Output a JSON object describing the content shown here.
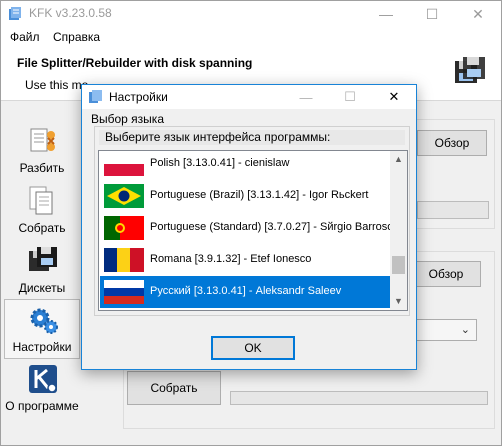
{
  "window": {
    "title": "KFK v3.23.0.58",
    "min_glyph": "—",
    "max_glyph": "☐",
    "close_glyph": "✕"
  },
  "menu": [
    "Файл",
    "Справка"
  ],
  "header": {
    "title": "File Splitter/Rebuilder with disk spanning",
    "description": "Use this mo"
  },
  "sidebar": {
    "items": [
      {
        "label": "Разбить",
        "icon": "split-icon"
      },
      {
        "label": "Собрать",
        "icon": "rebuild-icon"
      },
      {
        "label": "Дискеты",
        "icon": "diskette-icon"
      },
      {
        "label": "Настройки",
        "icon": "gears-icon"
      },
      {
        "label": "О программе",
        "icon": "about-icon"
      }
    ]
  },
  "panel": {
    "browse1": "Обзор",
    "browse2": "Обзор",
    "rebuild": "Собрать"
  },
  "dialog": {
    "title": "Настройки",
    "group_label": "Выбор языка",
    "list_header": "Выберите язык интерфейса программы:",
    "languages": [
      "Polish [3.13.0.41] - cienislaw",
      "Portuguese (Brazil) [3.13.1.42] - Igor Rьckert",
      "Portuguese (Standard) [3.7.0.27] - Sйrgio Barroso",
      "Romana [3.9.1.32] - Etef Ionesco",
      "Русский [3.13.0.41] - Aleksandr Saleev"
    ],
    "selected_index": 4,
    "ok_label": "OK",
    "scroll_up": "▲",
    "scroll_down": "▼"
  },
  "colors": {
    "selection": "#0078d7",
    "accent_border": "#1883d7"
  }
}
